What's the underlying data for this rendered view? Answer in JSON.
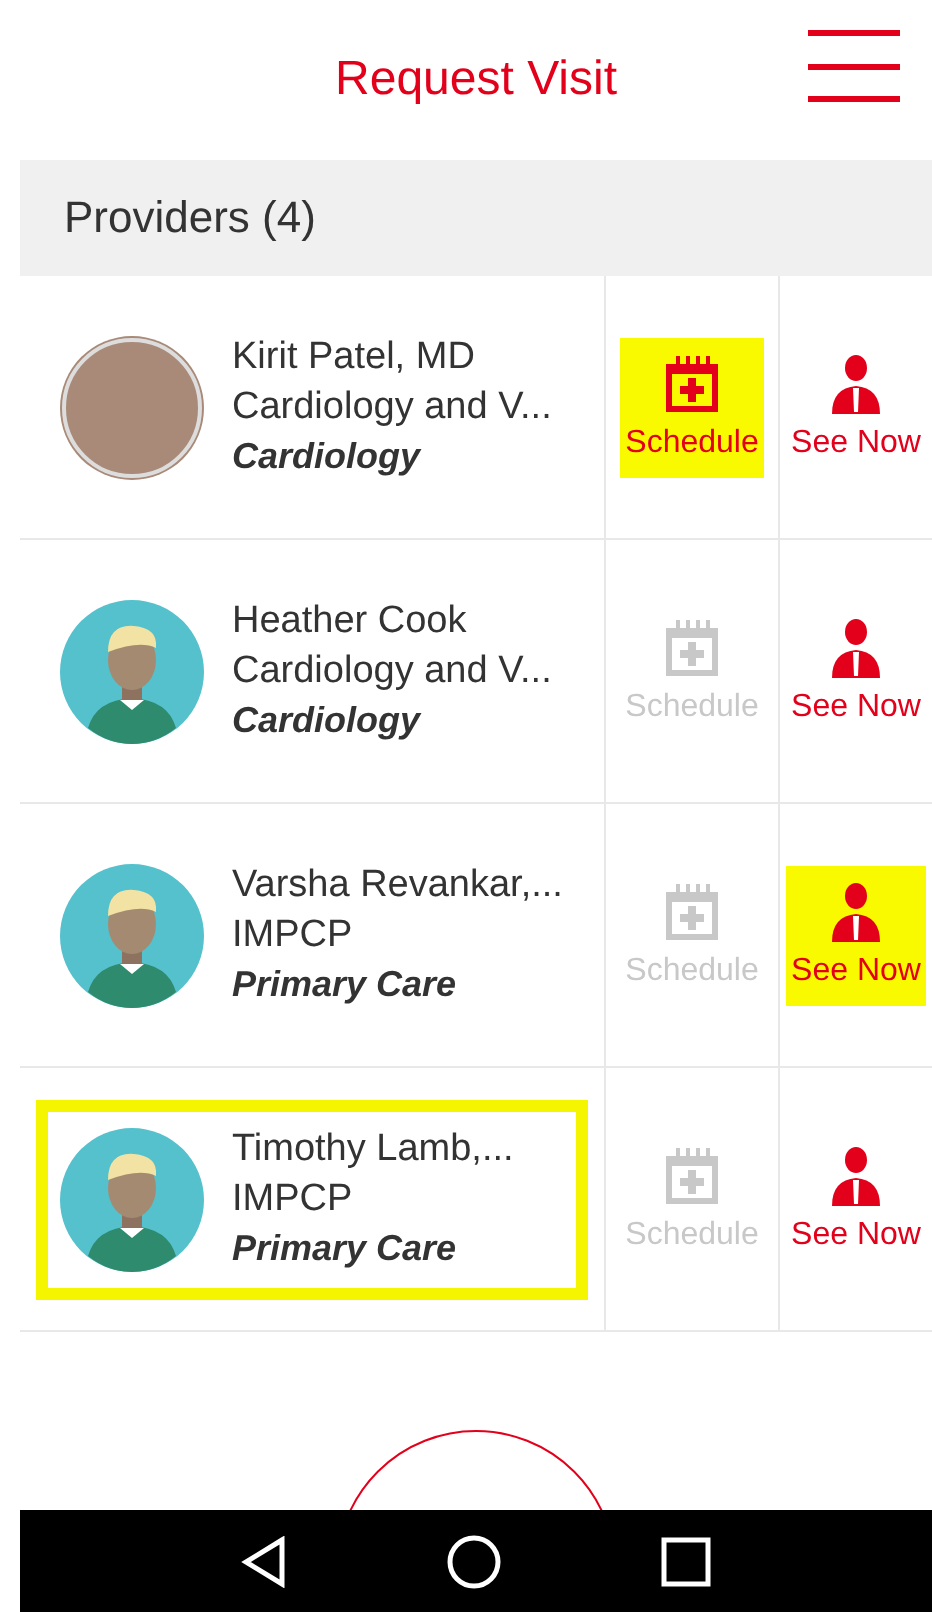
{
  "header": {
    "title": "Request Visit"
  },
  "providers_header": {
    "label": "Providers (4)"
  },
  "providers": [
    {
      "name": "Kirit Patel, MD",
      "department": "Cardiology and V...",
      "specialty": "Cardiology",
      "kind": "photo",
      "highlighted": false,
      "schedule": {
        "label": "Schedule",
        "enabled": true,
        "highlighted": true
      },
      "see_now": {
        "label": "See Now",
        "enabled": true,
        "highlighted": false
      }
    },
    {
      "name": "Heather Cook",
      "department": "Cardiology and V...",
      "specialty": "Cardiology",
      "kind": "generic",
      "highlighted": false,
      "schedule": {
        "label": "Schedule",
        "enabled": false,
        "highlighted": false
      },
      "see_now": {
        "label": "See Now",
        "enabled": true,
        "highlighted": false
      }
    },
    {
      "name": "Varsha Revankar,...",
      "department": "IMPCP",
      "specialty": "Primary Care",
      "kind": "generic",
      "highlighted": false,
      "schedule": {
        "label": "Schedule",
        "enabled": false,
        "highlighted": false
      },
      "see_now": {
        "label": "See Now",
        "enabled": true,
        "highlighted": true
      }
    },
    {
      "name": "Timothy Lamb,...",
      "department": "IMPCP",
      "specialty": "Primary Care",
      "kind": "generic",
      "highlighted": true,
      "schedule": {
        "label": "Schedule",
        "enabled": false,
        "highlighted": false
      },
      "see_now": {
        "label": "See Now",
        "enabled": true,
        "highlighted": false
      }
    }
  ]
}
